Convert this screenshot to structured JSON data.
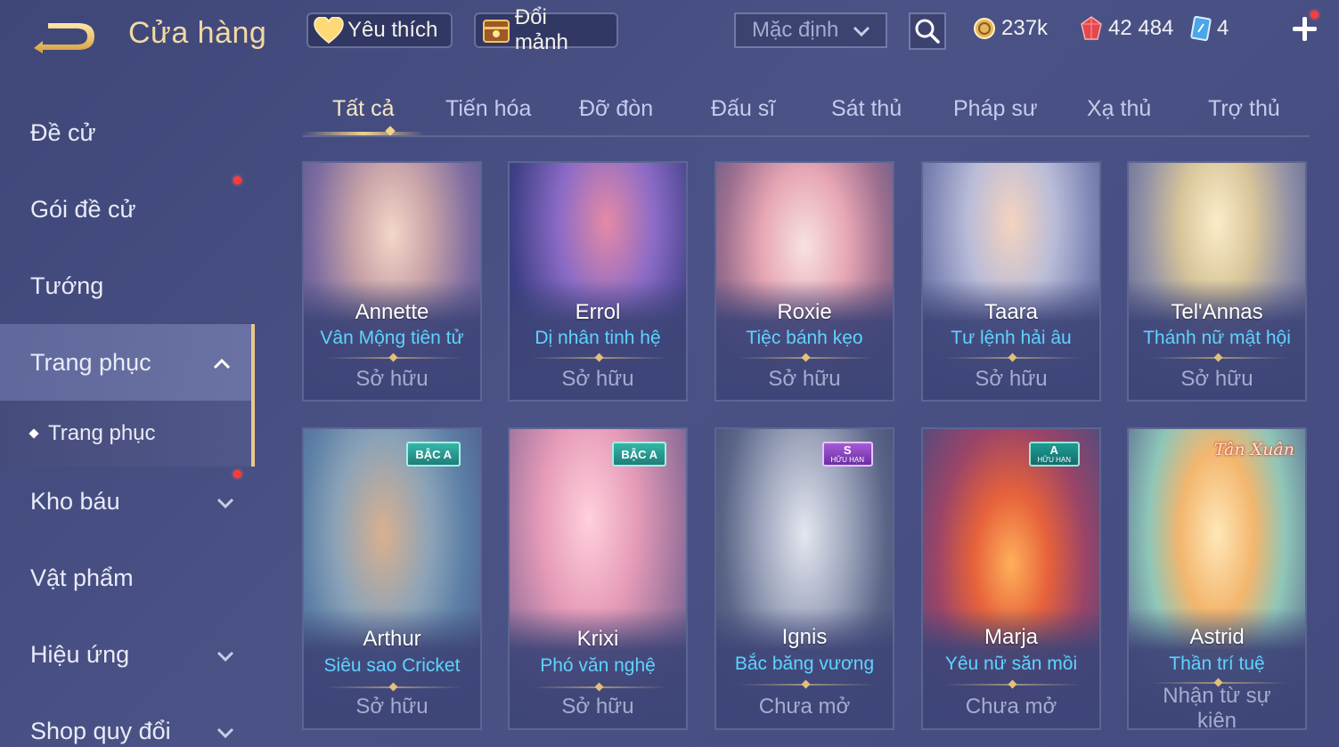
{
  "header": {
    "title": "Cửa hàng",
    "favorite_label": "Yêu thích",
    "exchange_label": "Đổi mảnh",
    "sort_label": "Mặc định",
    "gold": "237k",
    "coupons": "42 484",
    "vouchers": "4"
  },
  "sidebar": {
    "items": [
      {
        "label": "Đề cử"
      },
      {
        "label": "Gói đề cử"
      },
      {
        "label": "Tướng"
      },
      {
        "label": "Trang phục"
      },
      {
        "label": "Trang phục"
      },
      {
        "label": "Kho báu"
      },
      {
        "label": "Vật phẩm"
      },
      {
        "label": "Hiệu ứng"
      },
      {
        "label": "Shop quy đổi"
      }
    ]
  },
  "tabs": [
    {
      "label": "Tất cả"
    },
    {
      "label": "Tiến hóa"
    },
    {
      "label": "Đỡ đòn"
    },
    {
      "label": "Đấu sĩ"
    },
    {
      "label": "Sát thủ"
    },
    {
      "label": "Pháp sư"
    },
    {
      "label": "Xạ thủ"
    },
    {
      "label": "Trợ thủ"
    }
  ],
  "cards": [
    {
      "hero": "Annette",
      "skin": "Vân Mộng tiên tử",
      "status": "Sở hữu",
      "badge": ""
    },
    {
      "hero": "Errol",
      "skin": "Dị nhân tinh hệ",
      "status": "Sở hữu",
      "badge": ""
    },
    {
      "hero": "Roxie",
      "skin": "Tiệc bánh kẹo",
      "status": "Sở hữu",
      "badge": ""
    },
    {
      "hero": "Taara",
      "skin": "Tư lệnh hải âu",
      "status": "Sở hữu",
      "badge": ""
    },
    {
      "hero": "Tel'Annas",
      "skin": "Thánh nữ mật hội",
      "status": "Sở hữu",
      "badge": ""
    },
    {
      "hero": "Arthur",
      "skin": "Siêu sao Cricket",
      "status": "Sở hữu",
      "badge": "BẬC A"
    },
    {
      "hero": "Krixi",
      "skin": "Phó văn nghệ",
      "status": "Sở hữu",
      "badge": "BẬC A"
    },
    {
      "hero": "Ignis",
      "skin": "Bắc băng vương",
      "status": "Chưa mở",
      "badge": "S",
      "badge_sub": "HỮU HẠN"
    },
    {
      "hero": "Marja",
      "skin": "Yêu nữ săn mồi",
      "status": "Chưa mở",
      "badge": "A",
      "badge_sub": "HỮU HẠN"
    },
    {
      "hero": "Astrid",
      "skin": "Thần trí tuệ",
      "status": "Nhận từ sự kiện",
      "badge": "Tân Xuân"
    }
  ],
  "colors": {
    "accent_gold": "#e9c98b",
    "skin_blue": "#5fd3ff",
    "background": "#444b7e",
    "notify_red": "#ff3b3b"
  }
}
